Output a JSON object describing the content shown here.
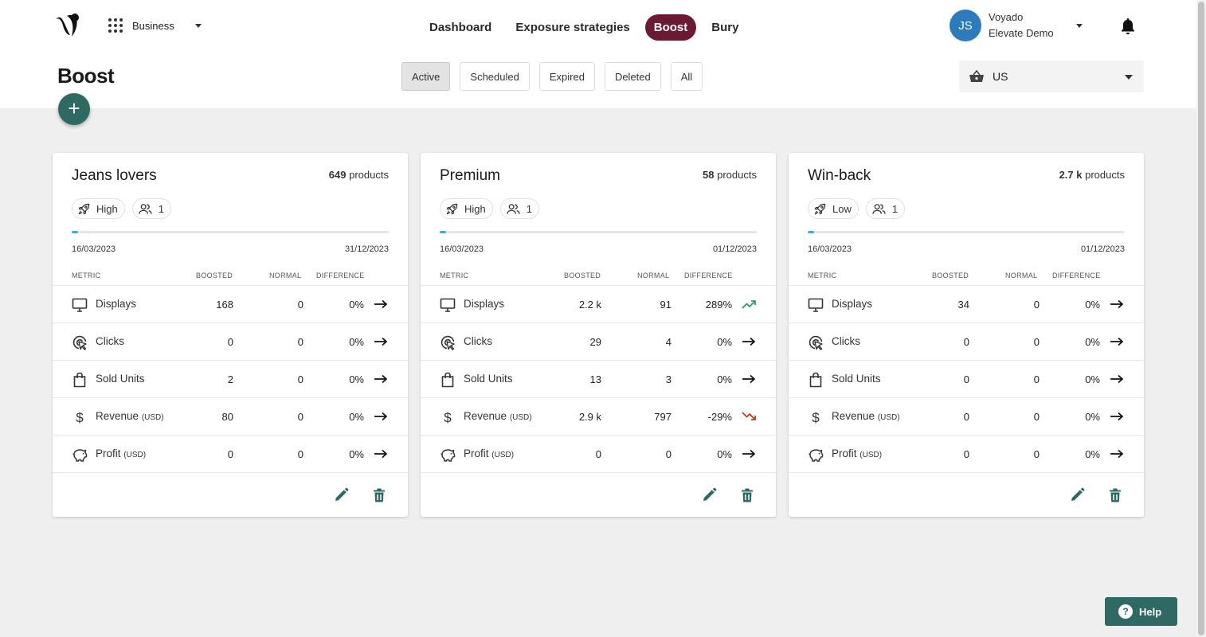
{
  "header": {
    "workspace": "Business",
    "nav": [
      "Dashboard",
      "Exposure strategies",
      "Boost",
      "Bury"
    ],
    "active_nav": "Boost",
    "user": {
      "initials": "JS",
      "name": "Voyado",
      "org": "Elevate Demo"
    }
  },
  "page": {
    "title": "Boost",
    "filters": [
      "Active",
      "Scheduled",
      "Expired",
      "Deleted",
      "All"
    ],
    "active_filter": "Active",
    "market": "US"
  },
  "columns": {
    "metric": "METRIC",
    "boosted": "BOOSTED",
    "normal": "NORMAL",
    "difference": "DIFFERENCE"
  },
  "metric_labels": [
    "Displays",
    "Clicks",
    "Sold Units",
    "Revenue",
    "Profit"
  ],
  "currency_suffix": "(USD)",
  "cards": [
    {
      "name": "Jeans lovers",
      "count": "649",
      "count_label": "products",
      "level": "High",
      "audiences": "1",
      "progress": 0.02,
      "start": "16/03/2023",
      "end": "31/12/2023",
      "rows": [
        {
          "boosted": "168",
          "normal": "0",
          "diff": "0%",
          "trend": "flat"
        },
        {
          "boosted": "0",
          "normal": "0",
          "diff": "0%",
          "trend": "flat"
        },
        {
          "boosted": "2",
          "normal": "0",
          "diff": "0%",
          "trend": "flat"
        },
        {
          "boosted": "80",
          "normal": "0",
          "diff": "0%",
          "trend": "flat"
        },
        {
          "boosted": "0",
          "normal": "0",
          "diff": "0%",
          "trend": "flat"
        }
      ]
    },
    {
      "name": "Premium",
      "count": "58",
      "count_label": "products",
      "level": "High",
      "audiences": "1",
      "progress": 0.02,
      "start": "16/03/2023",
      "end": "01/12/2023",
      "rows": [
        {
          "boosted": "2.2 k",
          "normal": "91",
          "diff": "289%",
          "trend": "up"
        },
        {
          "boosted": "29",
          "normal": "4",
          "diff": "0%",
          "trend": "flat"
        },
        {
          "boosted": "13",
          "normal": "3",
          "diff": "0%",
          "trend": "flat"
        },
        {
          "boosted": "2.9 k",
          "normal": "797",
          "diff": "-29%",
          "trend": "down"
        },
        {
          "boosted": "0",
          "normal": "0",
          "diff": "0%",
          "trend": "flat"
        }
      ]
    },
    {
      "name": "Win-back",
      "count": "2.7 k",
      "count_label": "products",
      "level": "Low",
      "audiences": "1",
      "progress": 0.02,
      "start": "16/03/2023",
      "end": "01/12/2023",
      "rows": [
        {
          "boosted": "34",
          "normal": "0",
          "diff": "0%",
          "trend": "flat"
        },
        {
          "boosted": "0",
          "normal": "0",
          "diff": "0%",
          "trend": "flat"
        },
        {
          "boosted": "0",
          "normal": "0",
          "diff": "0%",
          "trend": "flat"
        },
        {
          "boosted": "0",
          "normal": "0",
          "diff": "0%",
          "trend": "flat"
        },
        {
          "boosted": "0",
          "normal": "0",
          "diff": "0%",
          "trend": "flat"
        }
      ]
    }
  ],
  "help_label": "Help",
  "colors": {
    "accent": "#2e6a63",
    "active_nav": "#6b1a33",
    "up": "#2e9b5a",
    "down": "#c0392b",
    "avatar": "#2b7bbd"
  }
}
